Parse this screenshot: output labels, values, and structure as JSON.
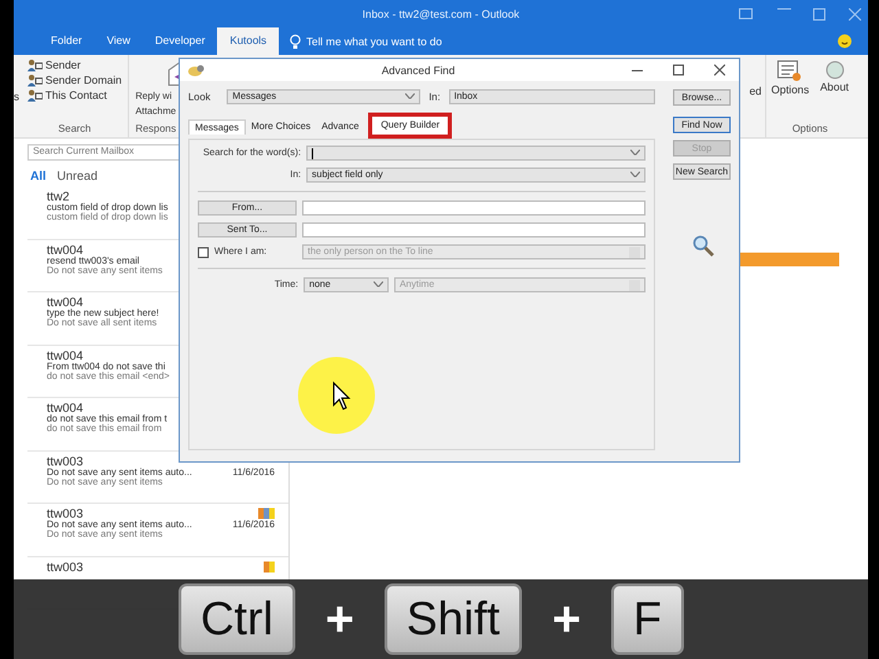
{
  "window": {
    "title": "Inbox - ttw2@test.com - Outlook"
  },
  "ribbon_tabs": [
    {
      "label": "Folder",
      "selected": false
    },
    {
      "label": "View",
      "selected": false
    },
    {
      "label": "Developer",
      "selected": false
    },
    {
      "label": "Kutools",
      "selected": true
    }
  ],
  "tell_me": "Tell me what you want to do",
  "ribbon": {
    "cut_label": "s",
    "search_group": {
      "items": [
        "Sender",
        "Sender Domain",
        "This Contact"
      ],
      "label": "Search"
    },
    "respond_group": {
      "items": [
        "Reply wi",
        "Attachme"
      ],
      "label": "Respons"
    },
    "cut_right": "ed",
    "options_group": {
      "buttons": [
        "Options",
        "About"
      ],
      "label": "Options"
    }
  },
  "mailbox": {
    "search_placeholder": "Search Current Mailbox",
    "filters": [
      {
        "label": "All",
        "selected": true
      },
      {
        "label": "Unread",
        "selected": false
      }
    ],
    "messages": [
      {
        "sender": "ttw2",
        "subject": "custom field of drop down lis",
        "preview": "custom field of drop down lis"
      },
      {
        "sender": "ttw004",
        "subject": "resend ttw003's email",
        "preview": "Do not save any sent items"
      },
      {
        "sender": "ttw004",
        "subject": "type the new subject here!",
        "preview": "Do not save all sent items"
      },
      {
        "sender": "ttw004",
        "subject": "From ttw004   do not save thi",
        "preview": "do not save this email <end>"
      },
      {
        "sender": "ttw004",
        "subject": "do not save this email   from t",
        "preview": "do not save this email   from"
      },
      {
        "sender": "ttw003",
        "subject": "Do not save any sent items auto...",
        "preview": "Do not save any sent items",
        "date": "11/6/2016"
      },
      {
        "sender": "ttw003",
        "subject": "Do not save any sent items auto...",
        "preview": "Do not save any sent items",
        "date": "11/6/2016",
        "categories": [
          {
            "color": "#e8892a"
          },
          {
            "color": "#6f93c4"
          },
          {
            "color": "#f4d21c"
          }
        ]
      },
      {
        "sender": "ttw003",
        "categories": [
          {
            "color": "#e8892a"
          },
          {
            "color": "#f4d21c"
          }
        ]
      }
    ]
  },
  "dialog": {
    "title": "Advanced Find",
    "look_label": "Look",
    "look_value": "Messages",
    "in_label": "In:",
    "in_value": "Inbox",
    "browse": "Browse...",
    "tabs": [
      {
        "label": "Messages",
        "selected": true,
        "highlighted": false
      },
      {
        "label": "More Choices",
        "selected": false,
        "highlighted": false
      },
      {
        "label": "Advance",
        "selected": false,
        "highlighted": false
      },
      {
        "label": "Query Builder",
        "selected": false,
        "highlighted": true
      }
    ],
    "search_label": "Search for the word(s):",
    "search_in_label": "In:",
    "search_in_value": "subject field only",
    "from_button": "From...",
    "sent_to_button": "Sent To...",
    "where_label": "Where I am:",
    "where_checked": false,
    "where_value": "the only person on the To line",
    "time_label": "Time:",
    "time_value": "none",
    "time_range": "Anytime",
    "buttons": [
      {
        "label": "Find Now",
        "disabled": false,
        "default": true
      },
      {
        "label": "Stop",
        "disabled": true,
        "default": false
      },
      {
        "label": "New Search",
        "disabled": false,
        "default": false
      }
    ]
  },
  "keys_overlay": [
    {
      "kind": "key",
      "label": "Ctrl"
    },
    {
      "kind": "plus",
      "label": "+"
    },
    {
      "kind": "key",
      "label": "Shift"
    },
    {
      "kind": "plus",
      "label": "+"
    },
    {
      "kind": "key",
      "label": "F"
    }
  ]
}
